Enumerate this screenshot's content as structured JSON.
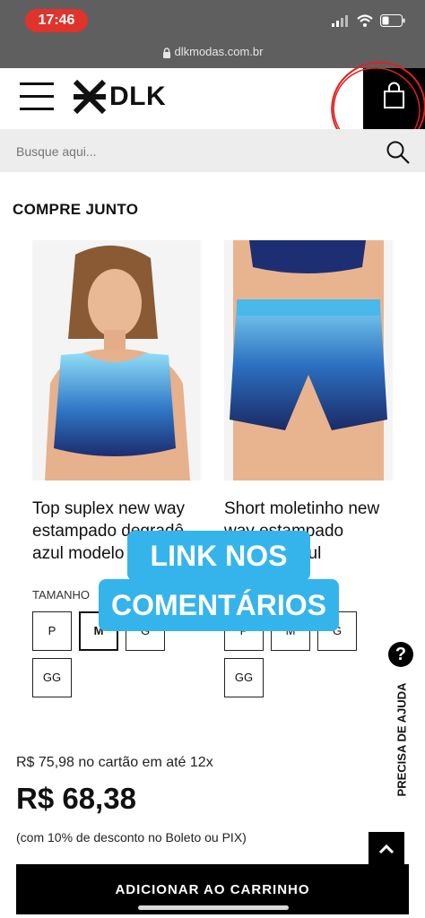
{
  "status_bar": {
    "time": "17:46"
  },
  "browser": {
    "url": "dlkmodas.com.br"
  },
  "header": {
    "logo_text": "DLK"
  },
  "search": {
    "placeholder": "Busque aqui..."
  },
  "section": {
    "title": "COMPRE JUNTO"
  },
  "products": [
    {
      "name_lines": [
        "Top suplex new way",
        "estampado degradê",
        "azul modelo"
      ],
      "size_label": "TAMANHO",
      "sizes": [
        "P",
        "M",
        "G",
        "GG"
      ],
      "selected_size": "M"
    },
    {
      "name_lines": [
        "Short moletinho new",
        "way estampado",
        "zul"
      ],
      "sizes": [
        "P",
        "M",
        "G",
        "GG"
      ]
    }
  ],
  "overlay": {
    "line1": "LINK NOS",
    "line2": "COMENTÁRIOS"
  },
  "help": {
    "label": "PRECISA DE AJUDA",
    "icon_text": "?"
  },
  "pricing": {
    "installment": "R$ 75,98 no cartão em até 12x",
    "price": "R$ 68,38",
    "discount_note": "(com 10% de desconto no Boleto ou PIX)"
  },
  "cart": {
    "button_label": "ADICIONAR AO CARRINHO"
  },
  "colors": {
    "accent_overlay": "#35b4ec",
    "status_bar": "#5f5f5f",
    "time_pill": "#e0332b",
    "scribble": "#e02020"
  }
}
